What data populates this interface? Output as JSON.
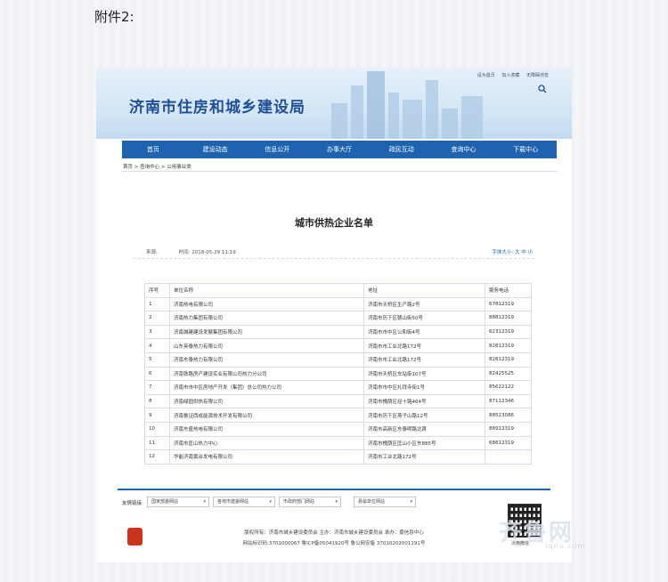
{
  "attachment_label": "附件2:",
  "header": {
    "site_title": "济南市住房和城乡建设局",
    "top_links": [
      "设为首页",
      "加入收藏",
      "无障碍浏览"
    ]
  },
  "nav": [
    "首页",
    "建设动态",
    "信息公开",
    "办事大厅",
    "政民互动",
    "查询中心",
    "下载中心"
  ],
  "breadcrumb": "首页 > 查询中心 > 公用事业类",
  "article": {
    "title": "城市供热企业名单",
    "source_label": "来源:",
    "time_label": "时间:",
    "time_value": "2018-05-29 11:19",
    "font_size_label": "字体大小:",
    "font_size_options": [
      "大",
      "中",
      "小"
    ]
  },
  "table": {
    "headers": [
      "序号",
      "单位名称",
      "地址",
      "服务电话"
    ],
    "rows": [
      [
        "1",
        "济南热电有限公司",
        "济南市天桥区生产路2号",
        "67812319"
      ],
      [
        "2",
        "济南热力集团有限公司",
        "济南市历下区朝山街50号",
        "88812319"
      ],
      [
        "3",
        "济南城建建设发展集团有限公司",
        "济南市市中区公和街4号",
        "62312319"
      ],
      [
        "4",
        "山东英泰热力有限公司",
        "济南市市工业北路172号",
        "82812319"
      ],
      [
        "5",
        "济南东泰热力有限公司",
        "济南市市工业北路172号",
        "82812319"
      ],
      [
        "6",
        "济南铁路房产建设实业有限公司热力分公司",
        "济南市天桥区车站街107号",
        "82425525"
      ],
      [
        "7",
        "济南市市中区房地产开发（集团）总公司热力公司",
        "济南市市中区礼拜寺街1号",
        "85622122"
      ],
      [
        "8",
        "济南绿园供热有限公司",
        "济南市槐荫区经十路464号",
        "87112346"
      ],
      [
        "9",
        "济南鲁证西成能源技术开发有限公司",
        "济南市历下区燕子山路12号",
        "88523086"
      ],
      [
        "10",
        "济南东盛热电有限公司",
        "济南市高新区东泰明路北首",
        "88912319"
      ],
      [
        "11",
        "济南市匡山热力中心",
        "济南市槐荫区匡山小区东885号",
        "68812319"
      ],
      [
        "12",
        "华能济南黄台发电有限公司",
        "济南市工业北路172号",
        ""
      ]
    ]
  },
  "footer": {
    "links_label": "友情链接:",
    "selects": [
      "国家部委网站",
      "各地市建委网站",
      "市政府部门网站",
      "县属单位网站"
    ],
    "line1": "版权所有：济南市城乡建设委员会  主办：济南市城乡建设委员会  承办：委信息中心",
    "line2": "网站标识码:3701000067  鲁ICP备05041920号  鲁公网安备 37010202001191号",
    "qr_label": "济南微信"
  },
  "watermark": {
    "main": "齐鲁网",
    "sub": "iqilu.com"
  }
}
